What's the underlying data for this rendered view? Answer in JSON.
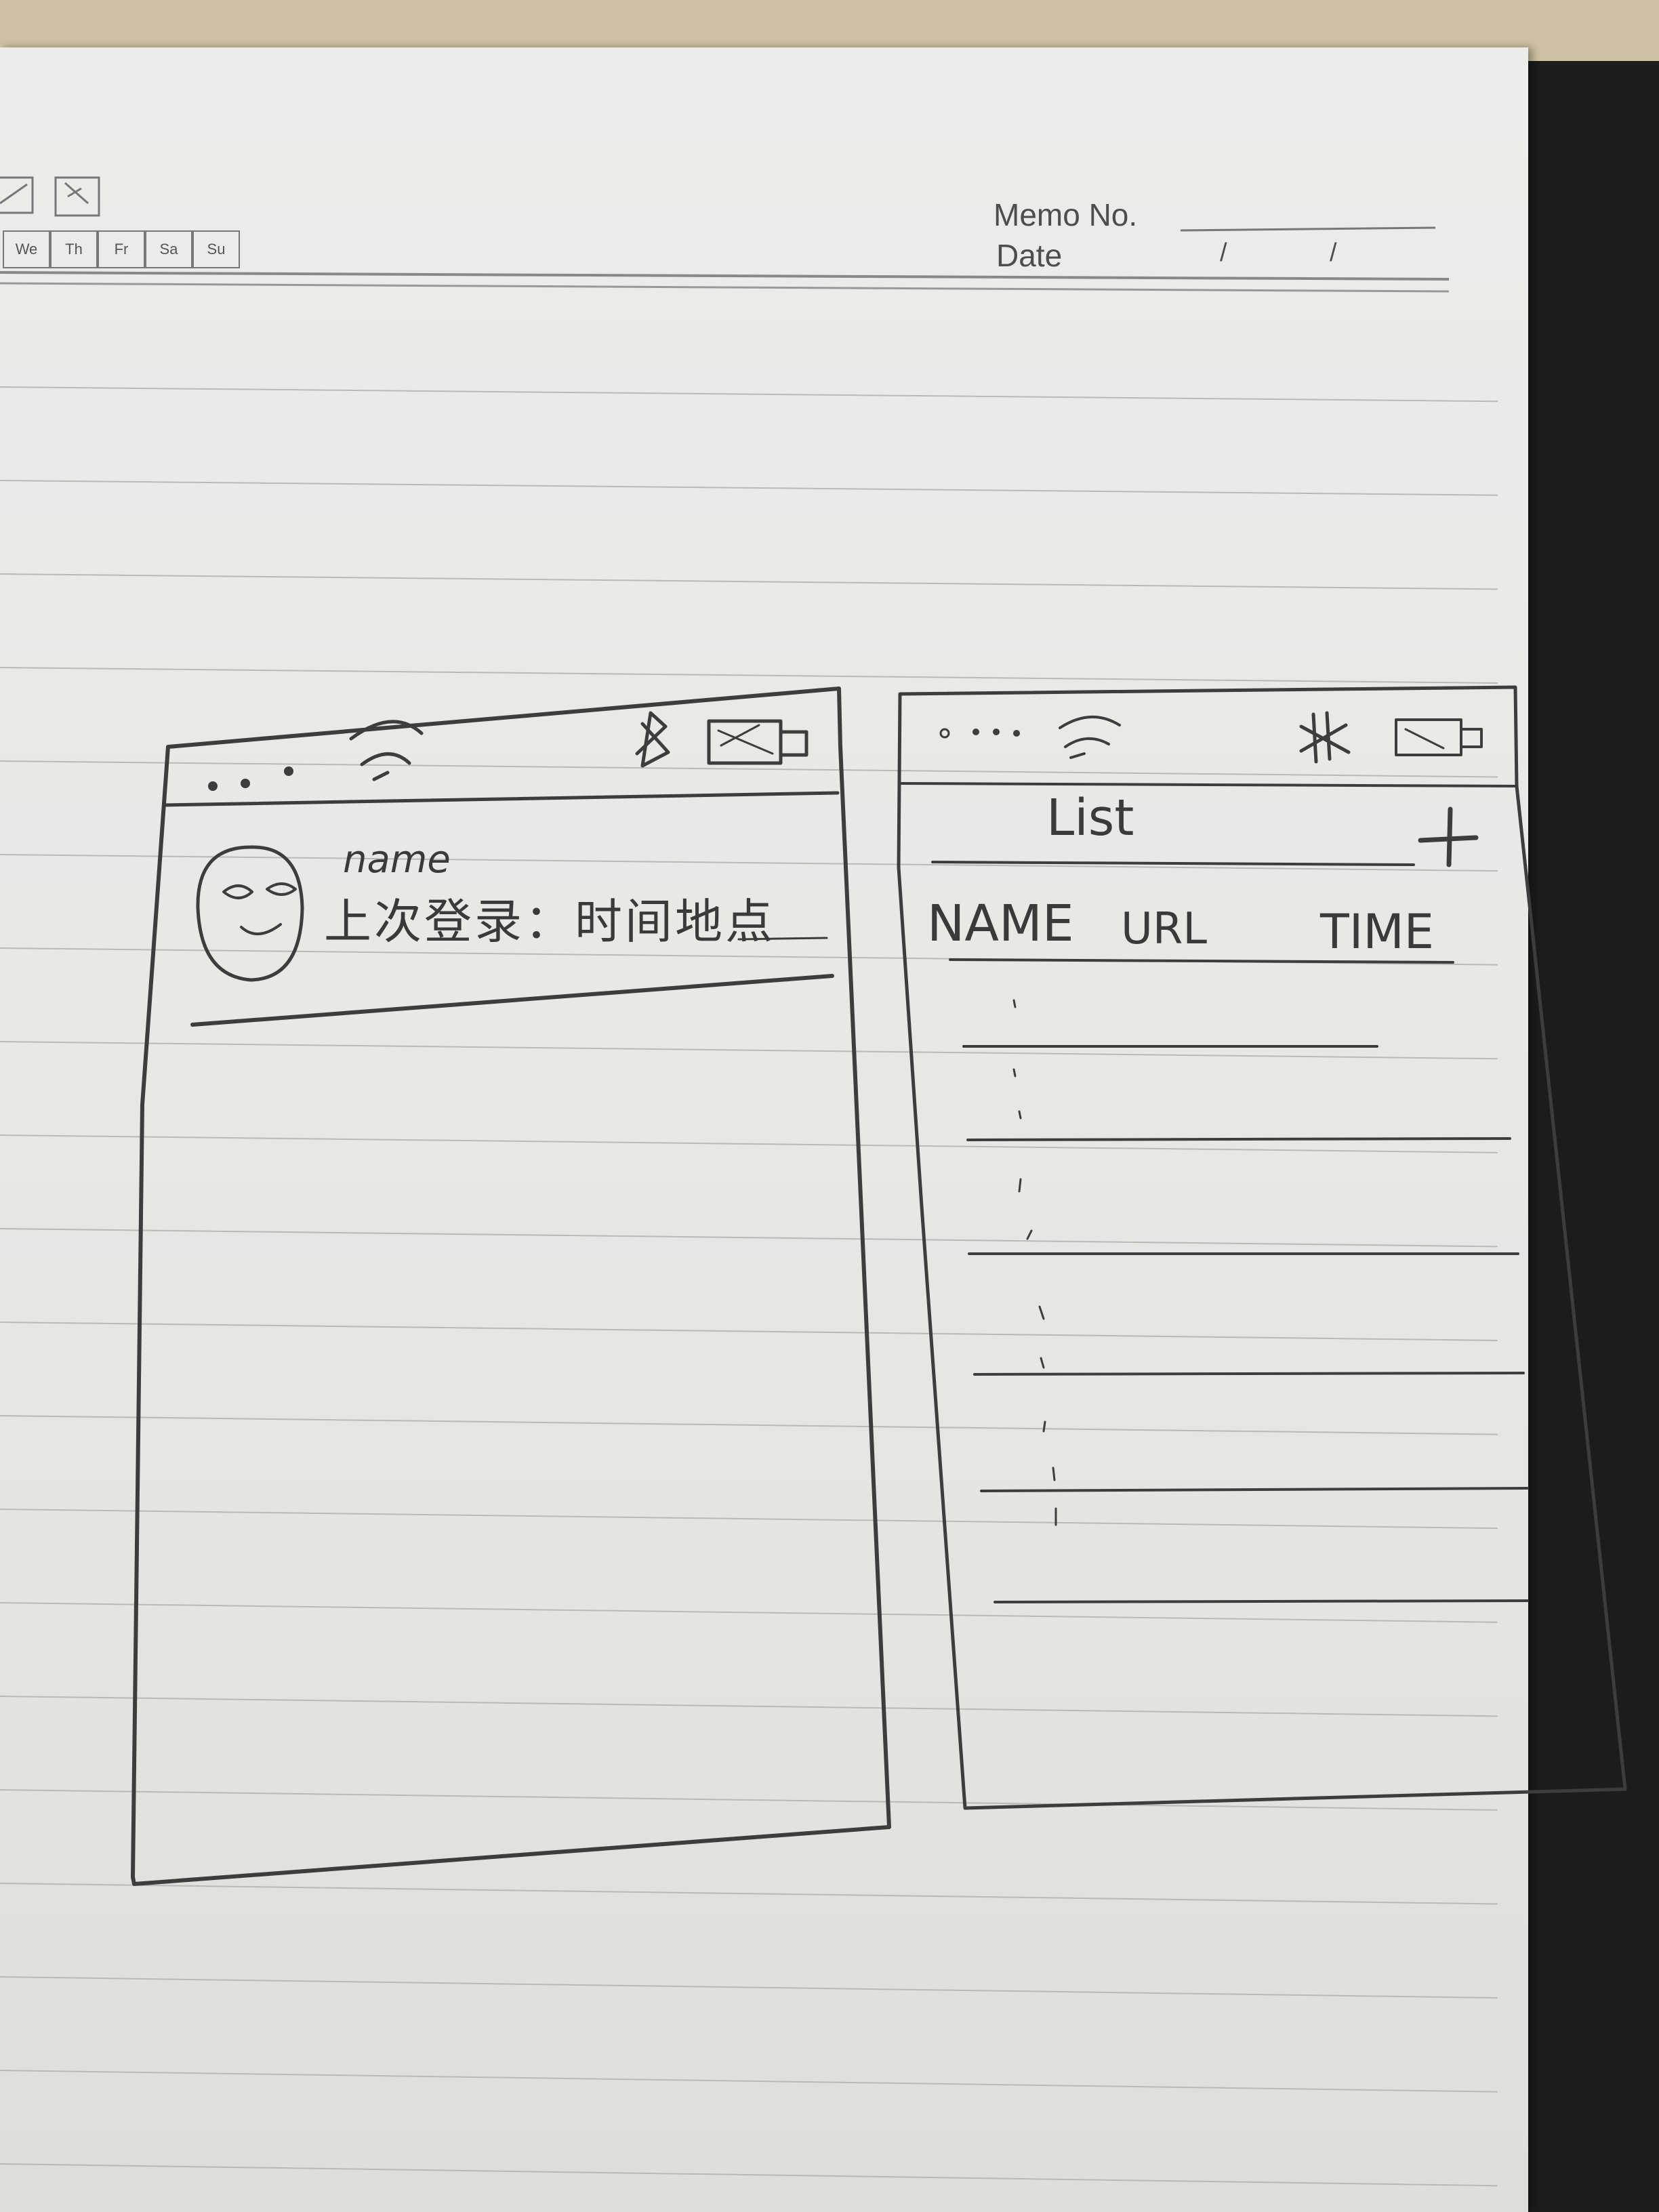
{
  "notebook_header": {
    "memo_label": "Memo No.",
    "date_label": "Date",
    "date_slash_1": "/",
    "date_slash_2": "/",
    "days": [
      "We",
      "Th",
      "Fr",
      "Sa",
      "Su"
    ]
  },
  "sketch_left_screen": {
    "status_bar": {
      "icons": [
        "signal-dots-icon",
        "wifi-icon",
        "bluetooth-icon",
        "battery-icon"
      ]
    },
    "profile_card": {
      "name": "name",
      "last_login": "上次登录：时间地点"
    }
  },
  "sketch_right_screen": {
    "status_bar": {
      "icons": [
        "signal-dots-icon",
        "wifi-icon",
        "bluetooth-icon",
        "battery-icon"
      ]
    },
    "title": "List",
    "add_label": "+",
    "columns": [
      "NAME",
      "URL",
      "TIME"
    ]
  }
}
